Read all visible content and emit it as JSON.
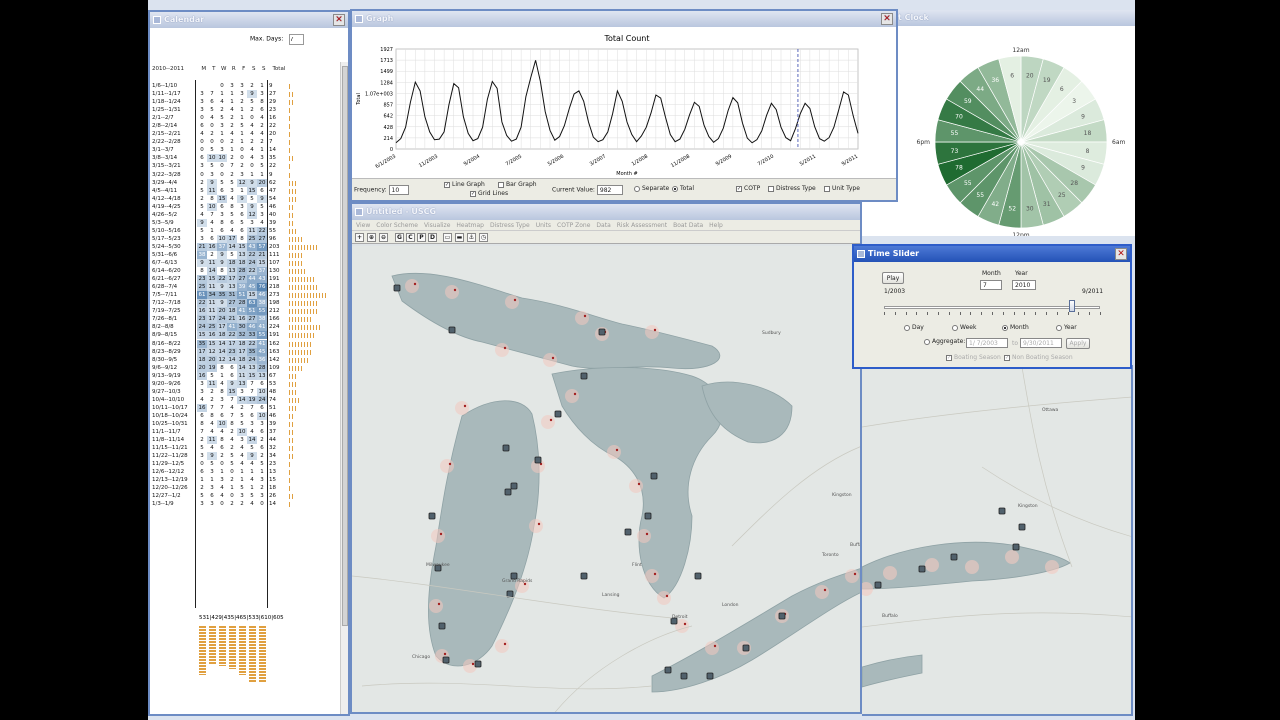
{
  "calendar": {
    "title": "Calendar",
    "max_days_label": "Max. Days:",
    "max_days_value": "7",
    "header_range": "2010--2011",
    "header_days": [
      "M",
      "T",
      "W",
      "R",
      "F",
      "S",
      "S"
    ],
    "header_total": "Total",
    "rows": [
      {
        "w": "1/6--1/10",
        "v": [
          "",
          "",
          "0",
          "3",
          "3",
          "2",
          "1"
        ],
        "t": "9"
      },
      {
        "w": "1/11--1/17",
        "v": [
          "3",
          "7",
          "1",
          "1",
          "3",
          "9",
          "3"
        ],
        "t": "27"
      },
      {
        "w": "1/18--1/24",
        "v": [
          "3",
          "6",
          "4",
          "1",
          "2",
          "5",
          "8"
        ],
        "t": "29"
      },
      {
        "w": "1/25--1/31",
        "v": [
          "3",
          "5",
          "2",
          "4",
          "1",
          "2",
          "6"
        ],
        "t": "23"
      },
      {
        "w": "2/1--2/7",
        "v": [
          "0",
          "4",
          "5",
          "2",
          "1",
          "0",
          "4"
        ],
        "t": "16"
      },
      {
        "w": "2/8--2/14",
        "v": [
          "6",
          "0",
          "3",
          "2",
          "5",
          "4",
          "2"
        ],
        "t": "22"
      },
      {
        "w": "2/15--2/21",
        "v": [
          "4",
          "2",
          "1",
          "4",
          "1",
          "4",
          "4"
        ],
        "t": "20"
      },
      {
        "w": "2/22--2/28",
        "v": [
          "0",
          "0",
          "0",
          "2",
          "1",
          "2",
          "2"
        ],
        "t": "7"
      },
      {
        "w": "3/1--3/7",
        "v": [
          "0",
          "5",
          "3",
          "1",
          "0",
          "4",
          "1"
        ],
        "t": "14"
      },
      {
        "w": "3/8--3/14",
        "v": [
          "6",
          "10",
          "10",
          "2",
          "0",
          "4",
          "3"
        ],
        "t": "35"
      },
      {
        "w": "3/15--3/21",
        "v": [
          "3",
          "5",
          "0",
          "7",
          "2",
          "0",
          "5"
        ],
        "t": "22"
      },
      {
        "w": "3/22--3/28",
        "v": [
          "0",
          "3",
          "0",
          "2",
          "3",
          "1",
          "1"
        ],
        "t": "9"
      },
      {
        "w": "3/29--4/4",
        "v": [
          "2",
          "9",
          "5",
          "5",
          "12",
          "9",
          "20"
        ],
        "t": "62"
      },
      {
        "w": "4/5--4/11",
        "v": [
          "5",
          "11",
          "6",
          "3",
          "1",
          "15",
          "6"
        ],
        "t": "47"
      },
      {
        "w": "4/12--4/18",
        "v": [
          "2",
          "8",
          "15",
          "4",
          "9",
          "5",
          "9"
        ],
        "t": "54"
      },
      {
        "w": "4/19--4/25",
        "v": [
          "5",
          "10",
          "6",
          "8",
          "3",
          "9",
          "5"
        ],
        "t": "46"
      },
      {
        "w": "4/26--5/2",
        "v": [
          "4",
          "7",
          "3",
          "5",
          "6",
          "12",
          "3"
        ],
        "t": "40"
      },
      {
        "w": "5/3--5/9",
        "v": [
          "9",
          "4",
          "8",
          "6",
          "5",
          "3",
          "4"
        ],
        "t": "39"
      },
      {
        "w": "5/10--5/16",
        "v": [
          "5",
          "1",
          "6",
          "4",
          "6",
          "11",
          "22"
        ],
        "t": "55"
      },
      {
        "w": "5/17--5/23",
        "v": [
          "3",
          "6",
          "10",
          "17",
          "8",
          "25",
          "27"
        ],
        "t": "96"
      },
      {
        "w": "5/24--5/30",
        "v": [
          "21",
          "16",
          "37",
          "14",
          "15",
          "43",
          "57"
        ],
        "t": "203"
      },
      {
        "w": "5/31--6/6",
        "v": [
          "38",
          "2",
          "9",
          "5",
          "13",
          "22",
          "21"
        ],
        "t": "111"
      },
      {
        "w": "6/7--6/13",
        "v": [
          "9",
          "11",
          "9",
          "18",
          "18",
          "24",
          "15"
        ],
        "t": "107"
      },
      {
        "w": "6/14--6/20",
        "v": [
          "8",
          "14",
          "8",
          "13",
          "28",
          "22",
          "37"
        ],
        "t": "130"
      },
      {
        "w": "6/21--6/27",
        "v": [
          "23",
          "15",
          "22",
          "17",
          "27",
          "44",
          "43"
        ],
        "t": "191"
      },
      {
        "w": "6/28--7/4",
        "v": [
          "25",
          "11",
          "9",
          "13",
          "39",
          "45",
          "76"
        ],
        "t": "218"
      },
      {
        "w": "7/5--7/11",
        "v": [
          "61",
          "34",
          "35",
          "31",
          "51",
          "15",
          "46"
        ],
        "t": "273"
      },
      {
        "w": "7/12--7/18",
        "v": [
          "22",
          "11",
          "9",
          "27",
          "28",
          "63",
          "38"
        ],
        "t": "198"
      },
      {
        "w": "7/19--7/25",
        "v": [
          "16",
          "11",
          "20",
          "18",
          "41",
          "51",
          "55"
        ],
        "t": "212"
      },
      {
        "w": "7/26--8/1",
        "v": [
          "23",
          "17",
          "24",
          "21",
          "16",
          "27",
          "38"
        ],
        "t": "166"
      },
      {
        "w": "8/2--8/8",
        "v": [
          "24",
          "25",
          "17",
          "41",
          "30",
          "46",
          "41"
        ],
        "t": "224"
      },
      {
        "w": "8/9--8/15",
        "v": [
          "15",
          "16",
          "18",
          "22",
          "32",
          "33",
          "55"
        ],
        "t": "191"
      },
      {
        "w": "8/16--8/22",
        "v": [
          "35",
          "15",
          "14",
          "17",
          "18",
          "22",
          "41"
        ],
        "t": "162"
      },
      {
        "w": "8/23--8/29",
        "v": [
          "17",
          "12",
          "14",
          "23",
          "17",
          "35",
          "45"
        ],
        "t": "163"
      },
      {
        "w": "8/30--9/5",
        "v": [
          "18",
          "20",
          "12",
          "14",
          "18",
          "24",
          "36"
        ],
        "t": "142"
      },
      {
        "w": "9/6--9/12",
        "v": [
          "20",
          "19",
          "8",
          "6",
          "14",
          "13",
          "28"
        ],
        "t": "109"
      },
      {
        "w": "9/13--9/19",
        "v": [
          "16",
          "5",
          "1",
          "6",
          "11",
          "15",
          "13"
        ],
        "t": "67"
      },
      {
        "w": "9/20--9/26",
        "v": [
          "3",
          "11",
          "4",
          "9",
          "13",
          "7",
          "6"
        ],
        "t": "53"
      },
      {
        "w": "9/27--10/3",
        "v": [
          "3",
          "2",
          "8",
          "15",
          "3",
          "7",
          "10"
        ],
        "t": "48"
      },
      {
        "w": "10/4--10/10",
        "v": [
          "4",
          "2",
          "3",
          "7",
          "14",
          "19",
          "24"
        ],
        "t": "74"
      },
      {
        "w": "10/11--10/17",
        "v": [
          "16",
          "7",
          "7",
          "4",
          "2",
          "7",
          "6"
        ],
        "t": "51"
      },
      {
        "w": "10/18--10/24",
        "v": [
          "6",
          "8",
          "6",
          "7",
          "5",
          "6",
          "10"
        ],
        "t": "46"
      },
      {
        "w": "10/25--10/31",
        "v": [
          "8",
          "4",
          "10",
          "8",
          "5",
          "3",
          "3"
        ],
        "t": "39"
      },
      {
        "w": "11/1--11/7",
        "v": [
          "7",
          "4",
          "4",
          "2",
          "10",
          "4",
          "6"
        ],
        "t": "37"
      },
      {
        "w": "11/8--11/14",
        "v": [
          "2",
          "11",
          "8",
          "4",
          "3",
          "14",
          "2"
        ],
        "t": "44"
      },
      {
        "w": "11/15--11/21",
        "v": [
          "5",
          "4",
          "6",
          "2",
          "4",
          "5",
          "6"
        ],
        "t": "32"
      },
      {
        "w": "11/22--11/28",
        "v": [
          "3",
          "9",
          "2",
          "5",
          "4",
          "9",
          "2"
        ],
        "t": "34"
      },
      {
        "w": "11/29--12/5",
        "v": [
          "0",
          "5",
          "0",
          "5",
          "4",
          "4",
          "5"
        ],
        "t": "23"
      },
      {
        "w": "12/6--12/12",
        "v": [
          "6",
          "3",
          "1",
          "0",
          "1",
          "1",
          "1"
        ],
        "t": "13"
      },
      {
        "w": "12/13--12/19",
        "v": [
          "1",
          "1",
          "3",
          "2",
          "1",
          "4",
          "3"
        ],
        "t": "15"
      },
      {
        "w": "12/20--12/26",
        "v": [
          "2",
          "3",
          "4",
          "1",
          "5",
          "1",
          "2"
        ],
        "t": "18"
      },
      {
        "w": "12/27--1/2",
        "v": [
          "5",
          "6",
          "4",
          "0",
          "3",
          "5",
          "3"
        ],
        "t": "26"
      },
      {
        "w": "1/3--1/9",
        "v": [
          "3",
          "3",
          "0",
          "2",
          "2",
          "4",
          "0"
        ],
        "t": "14"
      }
    ],
    "footer_totals": "531|429|435|465|533|610|605"
  },
  "graph": {
    "title_bar": "Graph",
    "chart_data": {
      "type": "line",
      "title": "Total Count",
      "xlabel": "Month #",
      "ylabel": "Total",
      "y_tick_labels": [
        "1927",
        "1713",
        "1499",
        "1284",
        "1.07e+003",
        "857",
        "642",
        "428",
        "214",
        "0"
      ],
      "x_tick_labels": [
        "6/1/2003",
        "11/2003",
        "9/2004",
        "7/2005",
        "5/2006",
        "3/2007",
        "1/2008",
        "11/2008",
        "9/2009",
        "7/2010",
        "5/2011",
        "9/2011"
      ],
      "ylim": [
        0,
        1927
      ],
      "series": [
        {
          "values": [
            120,
            200,
            420,
            900,
            1290,
            1120,
            620,
            330,
            180,
            190,
            330,
            850,
            1260,
            1180,
            620,
            300,
            160,
            200,
            420,
            960,
            1300,
            1170,
            520,
            260,
            150,
            190,
            420,
            1010,
            1380,
            1710,
            1300,
            720,
            360,
            170,
            240,
            450,
            780,
            1060,
            1120,
            920,
            520,
            230,
            140,
            180,
            330,
            680,
            1120,
            920,
            520,
            280,
            140,
            250,
            420,
            700,
            1040,
            980,
            610,
            280,
            140,
            190,
            380,
            660,
            900,
            820,
            460,
            240,
            130,
            200,
            400,
            740,
            990,
            890,
            500,
            210,
            120,
            180,
            350,
            650,
            880,
            760,
            420,
            220,
            160,
            390,
            680,
            880,
            780,
            430,
            200,
            150,
            220,
            420,
            760,
            1100,
            1040,
            640,
            300
          ]
        }
      ],
      "grid": true,
      "marker_x_label": "7/2010"
    },
    "frequency_label": "Frequency:",
    "frequency_value": "10",
    "line_graph_label": "Line Graph",
    "bar_graph_label": "Bar Graph",
    "grid_lines_label": "Grid Lines",
    "current_value_label": "Current Value:",
    "current_value": "982",
    "separate_label": "Separate",
    "total_label": "Total",
    "cotp_label": "COTP",
    "distress_label": "Distress Type",
    "unit_label": "Unit Type"
  },
  "clock": {
    "title_bar": "t Clock",
    "labels": {
      "top": "12am",
      "bottom": "12pm",
      "left": "6pm",
      "right": "6am"
    },
    "values": [
      20,
      19,
      6,
      3,
      9,
      18,
      8,
      9,
      28,
      25,
      31,
      30,
      52,
      42,
      55,
      55,
      78,
      73,
      55,
      70,
      59,
      44,
      36,
      6
    ],
    "colors": {
      "low": "#f4fbf2",
      "high": "#1f6b31"
    }
  },
  "map": {
    "title_bar": "Untitled - USCG",
    "menu": [
      "View",
      "Color Scheme",
      "Visualize",
      "Heatmap",
      "Distress Type",
      "Units",
      "COTP Zone",
      "Data",
      "Risk Assessment",
      "Boat Data",
      "Help"
    ],
    "tools": [
      "G",
      "C",
      "P",
      "D"
    ],
    "places": [
      "Ottawa",
      "Toronto",
      "Detroit",
      "Chicago",
      "Milwaukee",
      "Cleveland",
      "Buffalo",
      "Grand Rapids",
      "Sudbury",
      "Kingston",
      "Lansing",
      "Flint",
      "London"
    ]
  },
  "time_slider": {
    "title_bar": "Time Slider",
    "play_label": "Play",
    "month_label": "Month",
    "year_label": "Year",
    "month_value": "7",
    "year_value": "2010",
    "range_start": "1/2003",
    "range_end": "9/2011",
    "slider_fraction": 0.87,
    "day_label": "Day",
    "week_label": "Week",
    "month_opt_label": "Month",
    "year_opt_label": "Year",
    "aggregate_label": "Aggregate:",
    "agg_from": "1/ 7/2003",
    "to_label": "to",
    "agg_to": "9/30/2011",
    "apply_label": "Apply",
    "boating_label": "Boating Season",
    "non_boating_label": "Non Boating Season"
  }
}
